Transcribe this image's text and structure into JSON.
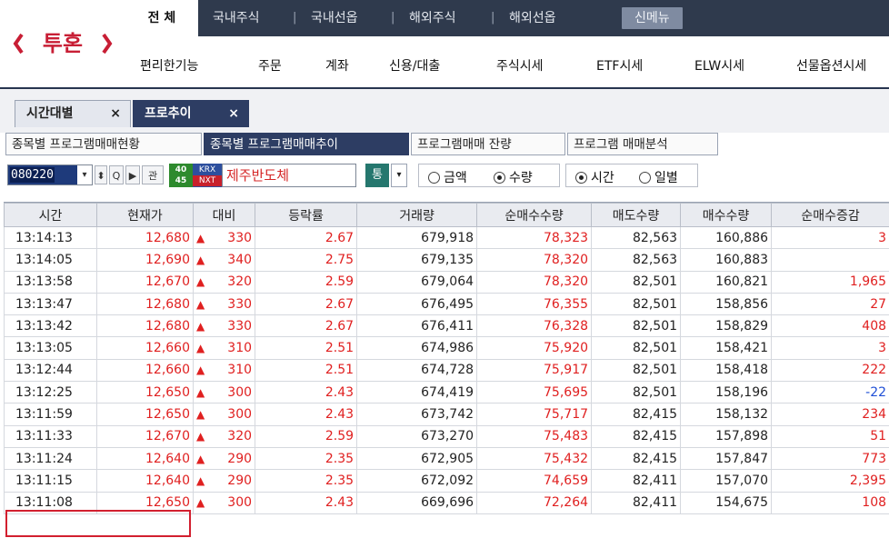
{
  "logo": {
    "text": "투혼"
  },
  "topnav": {
    "all": "전 체",
    "items": [
      "국내주식",
      "국내선옵",
      "해외주식",
      "해외선옵"
    ],
    "new": "신메뉴"
  },
  "subnav": [
    "편리한기능",
    "주문",
    "계좌",
    "신용/대출",
    "주식시세",
    "ETF시세",
    "ELW시세",
    "선물옵션시세"
  ],
  "tabs": [
    {
      "label": "시간대별",
      "close": "×"
    },
    {
      "label": "프로추이",
      "close": "×"
    }
  ],
  "subtabs": [
    "종목별 프로그램매매현황",
    "종목별 프로그램매매추이",
    "프로그램매매 잔량",
    "프로그램 매매분석"
  ],
  "toolbar": {
    "code": "080220",
    "code_drop": "▾",
    "updown": "⬍",
    "search": "Q",
    "play": "▶",
    "gwan": "관",
    "badge_top": "40",
    "badge_bottom": "45",
    "krx": "KRX",
    "nxt": "NXT",
    "stock_name": "제주반도체",
    "tong": "통",
    "tong_drop": "▾",
    "radio_amount": "금액",
    "radio_qty": "수량",
    "radio_time": "시간",
    "radio_daily": "일별"
  },
  "table": {
    "headers": [
      "시간",
      "현재가",
      "대비",
      "등락률",
      "거래량",
      "순매수수량",
      "매도수량",
      "매수수량",
      "순매수증감"
    ],
    "up_arrow": "▲",
    "rows": [
      {
        "time": "13:14:13",
        "price": "12,680",
        "diff": "330",
        "rate": "2.67",
        "volume": "679,918",
        "net": "78,323",
        "sell": "82,563",
        "buy": "160,886",
        "change": "3",
        "dir": "up"
      },
      {
        "time": "13:14:05",
        "price": "12,690",
        "diff": "340",
        "rate": "2.75",
        "volume": "679,135",
        "net": "78,320",
        "sell": "82,563",
        "buy": "160,883",
        "change": "",
        "dir": "up"
      },
      {
        "time": "13:13:58",
        "price": "12,670",
        "diff": "320",
        "rate": "2.59",
        "volume": "679,064",
        "net": "78,320",
        "sell": "82,501",
        "buy": "160,821",
        "change": "1,965",
        "dir": "up"
      },
      {
        "time": "13:13:47",
        "price": "12,680",
        "diff": "330",
        "rate": "2.67",
        "volume": "676,495",
        "net": "76,355",
        "sell": "82,501",
        "buy": "158,856",
        "change": "27",
        "dir": "up"
      },
      {
        "time": "13:13:42",
        "price": "12,680",
        "diff": "330",
        "rate": "2.67",
        "volume": "676,411",
        "net": "76,328",
        "sell": "82,501",
        "buy": "158,829",
        "change": "408",
        "dir": "up"
      },
      {
        "time": "13:13:05",
        "price": "12,660",
        "diff": "310",
        "rate": "2.51",
        "volume": "674,986",
        "net": "75,920",
        "sell": "82,501",
        "buy": "158,421",
        "change": "3",
        "dir": "up"
      },
      {
        "time": "13:12:44",
        "price": "12,660",
        "diff": "310",
        "rate": "2.51",
        "volume": "674,728",
        "net": "75,917",
        "sell": "82,501",
        "buy": "158,418",
        "change": "222",
        "dir": "up"
      },
      {
        "time": "13:12:25",
        "price": "12,650",
        "diff": "300",
        "rate": "2.43",
        "volume": "674,419",
        "net": "75,695",
        "sell": "82,501",
        "buy": "158,196",
        "change": "-22",
        "dir": "down"
      },
      {
        "time": "13:11:59",
        "price": "12,650",
        "diff": "300",
        "rate": "2.43",
        "volume": "673,742",
        "net": "75,717",
        "sell": "82,415",
        "buy": "158,132",
        "change": "234",
        "dir": "up"
      },
      {
        "time": "13:11:33",
        "price": "12,670",
        "diff": "320",
        "rate": "2.59",
        "volume": "673,270",
        "net": "75,483",
        "sell": "82,415",
        "buy": "157,898",
        "change": "51",
        "dir": "up"
      },
      {
        "time": "13:11:24",
        "price": "12,640",
        "diff": "290",
        "rate": "2.35",
        "volume": "672,905",
        "net": "75,432",
        "sell": "82,415",
        "buy": "157,847",
        "change": "773",
        "dir": "up"
      },
      {
        "time": "13:11:15",
        "price": "12,640",
        "diff": "290",
        "rate": "2.35",
        "volume": "672,092",
        "net": "74,659",
        "sell": "82,411",
        "buy": "157,070",
        "change": "2,395",
        "dir": "up"
      },
      {
        "time": "13:11:08",
        "price": "12,650",
        "diff": "300",
        "rate": "2.43",
        "volume": "669,696",
        "net": "72,264",
        "sell": "82,411",
        "buy": "154,675",
        "change": "108",
        "dir": "up"
      }
    ]
  }
}
